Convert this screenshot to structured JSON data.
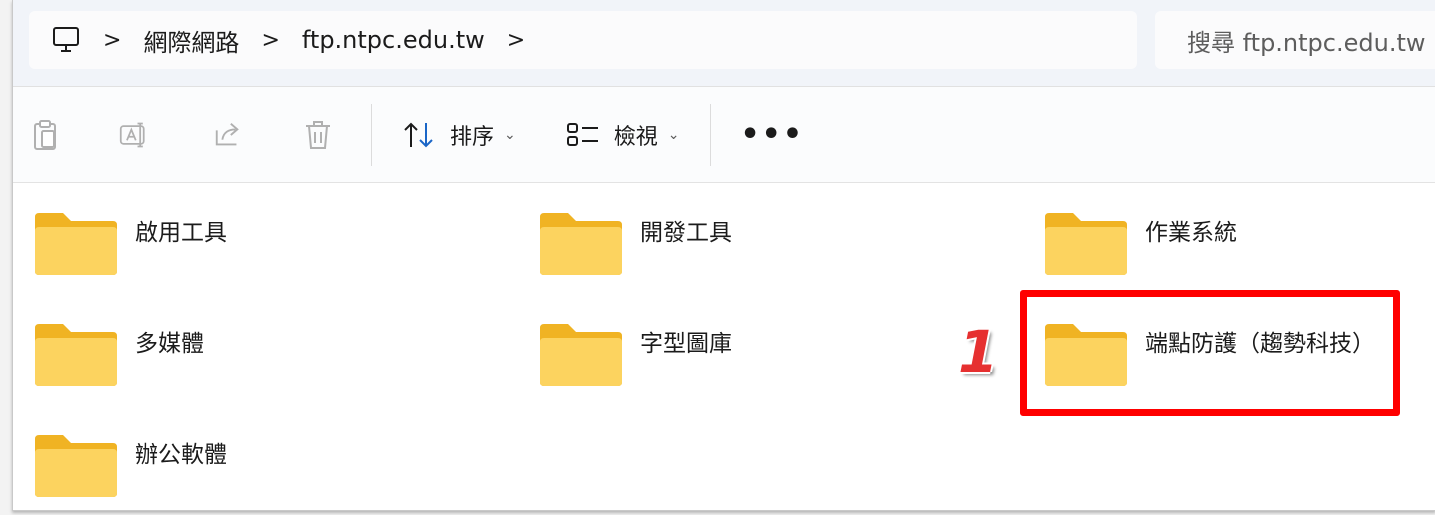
{
  "address": {
    "crumbs": [
      "網際網路",
      "ftp.ntpc.edu.tw"
    ],
    "search_placeholder": "搜尋 ftp.ntpc.edu.tw"
  },
  "toolbar": {
    "sort_label": "排序",
    "view_label": "檢視",
    "more_label": "•••"
  },
  "folders": [
    "啟用工具",
    "開發工具",
    "作業系統",
    "多媒體",
    "字型圖庫",
    "端點防護（趨勢科技）",
    "辦公軟體"
  ],
  "annotation": {
    "number": "1",
    "color": "#ff0000"
  },
  "colors": {
    "folder_front": "#fcd35f",
    "folder_back": "#f0b323",
    "accent_blue": "#1a66c7"
  }
}
